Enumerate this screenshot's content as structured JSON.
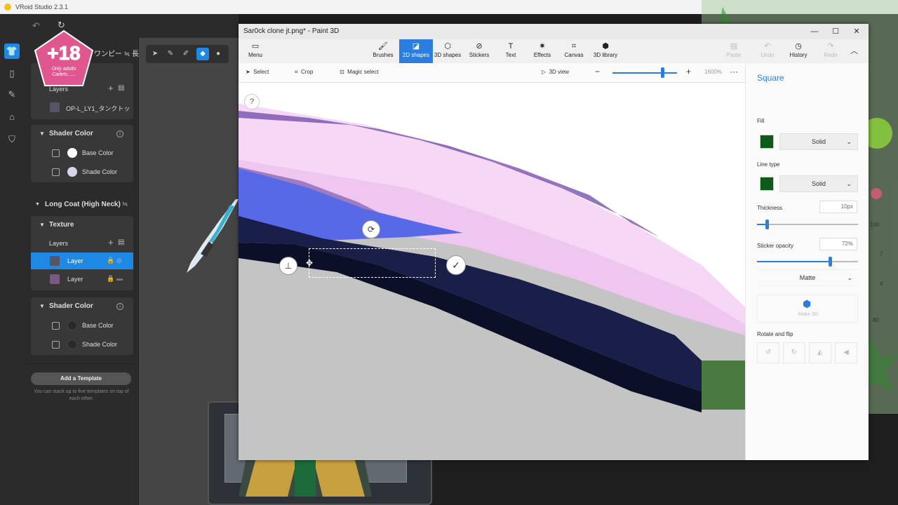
{
  "vroid": {
    "title": "VRoid Studio 2.3.1",
    "panel": {
      "item_name_fragment": "ワンピー",
      "item_name_suffix": "長",
      "layers_label": "Layers",
      "layer_top_name": "OP-L_LY1_タンクトッ",
      "shader_color_1": {
        "title": "Shader Color",
        "base": "Base Color",
        "shade": "Shade Color"
      },
      "coat_title": "Long Coat (High Neck)",
      "texture_title": "Texture",
      "layers_label_2": "Layers",
      "layer_selected": "Layer",
      "layer_second": "Layer",
      "shader_color_2": {
        "title": "Shader Color",
        "base": "Base Color",
        "shade": "Shade Color"
      },
      "add_template": "Add a Template",
      "template_hint": "You can stack up to five templates on top of each other."
    },
    "badge": {
      "main": "+18",
      "sub": "Only adults Cadets......"
    }
  },
  "paint3d": {
    "title": "Sar0ck clone jt.png* - Paint 3D",
    "ribbon": [
      {
        "label": "Menu",
        "icon": "folder-icon"
      },
      {
        "label": "Brushes",
        "icon": "brush-icon"
      },
      {
        "label": "2D shapes",
        "icon": "2d-shapes-icon"
      },
      {
        "label": "3D shapes",
        "icon": "3d-shapes-icon"
      },
      {
        "label": "Stickers",
        "icon": "sticker-icon"
      },
      {
        "label": "Text",
        "icon": "text-icon"
      },
      {
        "label": "Effects",
        "icon": "effects-icon"
      },
      {
        "label": "Canvas",
        "icon": "canvas-icon"
      },
      {
        "label": "3D library",
        "icon": "3d-library-icon"
      }
    ],
    "right_ribbon": {
      "paste": "Paste",
      "undo": "Undo",
      "history": "History",
      "redo": "Redo"
    },
    "subtoolbar": {
      "select": "Select",
      "crop": "Crop",
      "magic_select": "Magic select",
      "view_3d": "3D view",
      "zoom": "1600%"
    },
    "canvas_help": "?",
    "side_panel": {
      "title": "Square",
      "fill_label": "Fill",
      "fill_value": "Solid",
      "line_type_label": "Line type",
      "line_type_value": "Solid",
      "thickness_label": "Thickness",
      "thickness_value": "10px",
      "thickness_level": 0.1,
      "sticker_opacity_label": "Sticker opacity",
      "sticker_opacity_value": "72%",
      "sticker_opacity_level": 0.72,
      "finish_value": "Matte",
      "make_3d": "Make 3D",
      "rotate_flip_label": "Rotate and flip"
    },
    "zoom_level": 0.75
  },
  "overlay_numbers": [
    "100",
    "7",
    "4",
    "80"
  ],
  "colors": {
    "accent": "#2b7de0",
    "vroid_accent": "#1e88e5",
    "fill_color": "#0e5a18",
    "badge": "#e0578f"
  }
}
